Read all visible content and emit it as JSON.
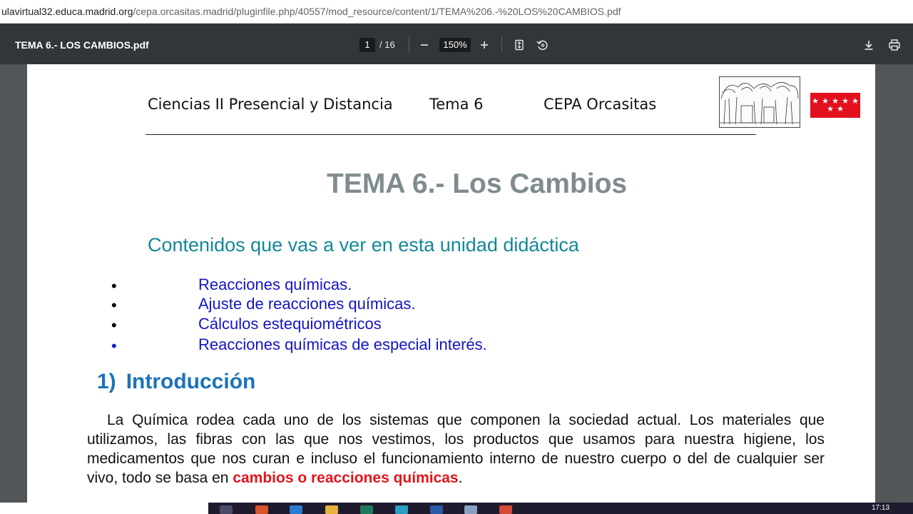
{
  "browser": {
    "url_host": "ulavirtual32.educa.madrid.org",
    "url_path": "/cepa.orcasitas.madrid/pluginfile.php/40557/mod_resource/content/1/TEMA%206.-%20LOS%20CAMBIOS.pdf"
  },
  "toolbar": {
    "doc_title": "TEMA 6.- LOS CAMBIOS.pdf",
    "current_page": "1",
    "total_pages": "/ 16",
    "zoom": "150%"
  },
  "icons": {
    "zoom_out": "minus-icon",
    "zoom_in": "plus-icon",
    "fit": "fit-page-icon",
    "rotate": "rotate-icon",
    "download": "download-icon",
    "print": "print-icon"
  },
  "document": {
    "header": {
      "course": "Ciencias II  Presencial y Distancia",
      "unit": "Tema 6",
      "school": "CEPA Orcasitas"
    },
    "title": "TEMA 6.- Los Cambios",
    "subtitle": "Contenidos que vas a ver en esta unidad didáctica",
    "contents": [
      "Reacciones químicas.",
      "Ajuste de reacciones químicas.",
      "Cálculos estequiométricos",
      "Reacciones químicas de especial interés."
    ],
    "section_number": "1)",
    "section_title": "Introducción",
    "paragraph_start": "La Química rodea cada uno de los sistemas que componen la sociedad actual. Los materiales que utilizamos, las fibras con las que nos vestimos, los productos que usamos para nuestra higiene, los medicamentos que nos curan e incluso el funcionamiento interno de nuestro cuerpo o del de cualquier ser vivo, todo se basa en ",
    "paragraph_highlight": "cambios o reacciones químicas",
    "paragraph_end": "."
  },
  "taskbar": {
    "time": "17:13"
  },
  "colors": {
    "title": "#7f8b8f",
    "subtitle": "#138896",
    "list": "#1414c4",
    "section": "#1a73b8",
    "highlight": "#e3141c",
    "flag": "#e2101c"
  }
}
